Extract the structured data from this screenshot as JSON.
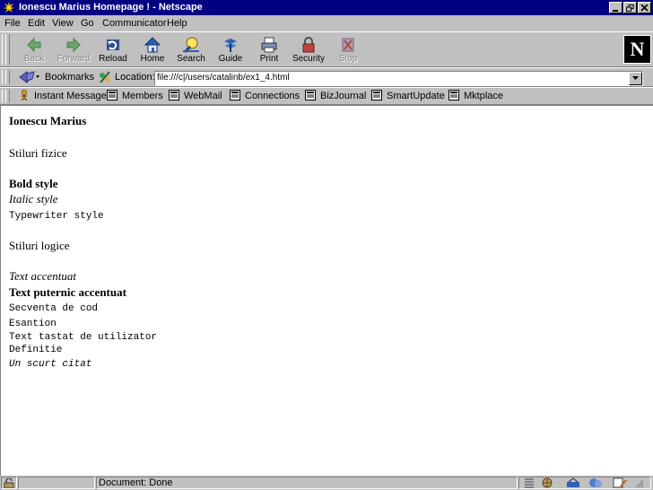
{
  "window": {
    "title": "Ionescu Marius Homepage ! - Netscape",
    "controls": [
      "minimize-icon",
      "maximize-icon",
      "close-icon"
    ]
  },
  "menubar": {
    "items": [
      "File",
      "Edit",
      "View",
      "Go",
      "Communicator",
      "Help"
    ]
  },
  "navigation": {
    "buttons": [
      {
        "label": "Back",
        "icon": "back-arrow-icon",
        "enabled": false
      },
      {
        "label": "Forward",
        "icon": "forward-arrow-icon",
        "enabled": false
      },
      {
        "label": "Reload",
        "icon": "reload-icon",
        "enabled": true
      },
      {
        "label": "Home",
        "icon": "home-icon",
        "enabled": true
      },
      {
        "label": "Search",
        "icon": "search-icon",
        "enabled": true
      },
      {
        "label": "Guide",
        "icon": "guide-icon",
        "enabled": true
      },
      {
        "label": "Print",
        "icon": "printer-icon",
        "enabled": true
      },
      {
        "label": "Security",
        "icon": "lock-icon",
        "enabled": true
      },
      {
        "label": "Stop",
        "icon": "stop-icon",
        "enabled": false
      }
    ],
    "logo": "N"
  },
  "location_bar": {
    "bookmarks_label": "Bookmarks",
    "location_label": "Location:",
    "url": "file:///c|/users/catalinb/ex1_4.html"
  },
  "personal_toolbar": {
    "items": [
      "Instant Message",
      "Members",
      "WebMail",
      "Connections",
      "BizJournal",
      "SmartUpdate",
      "Mktplace"
    ]
  },
  "page": {
    "heading": "Ionescu Marius",
    "physical_section": "Stiluri fizice",
    "bold_style": "Bold style",
    "italic_style": "Italic style",
    "typewriter_style": "Typewriter style",
    "logical_section": "Stiluri logice",
    "emphasis": "Text accentuat",
    "strong": "Text puternic accentuat",
    "code": "Secventa de cod",
    "sample": "Esantion",
    "keyboard": "Text tastat de utilizator",
    "definition": "Definitie",
    "cite": "Un scurt citat"
  },
  "status_bar": {
    "message": "Document: Done"
  },
  "colors": {
    "titlebar": "#000080",
    "chrome": "#c0c0c0",
    "content_bg": "#ffffff"
  }
}
